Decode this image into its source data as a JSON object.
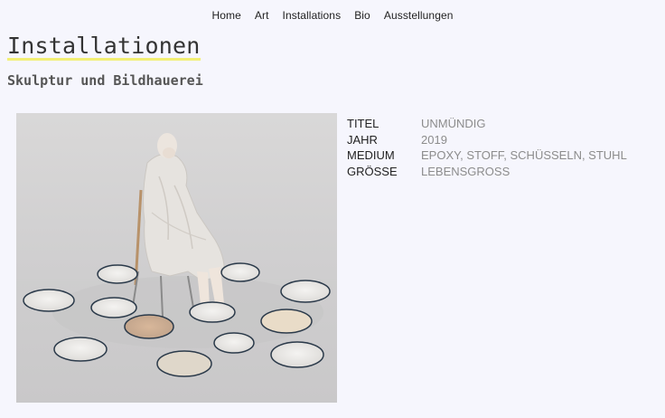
{
  "nav": {
    "items": [
      "Home",
      "Art",
      "Installations",
      "Bio",
      "Ausstellungen"
    ]
  },
  "page": {
    "title": "Installationen",
    "subtitle": "Skulptur und Bildhauerei"
  },
  "details": [
    {
      "key": "TITEL",
      "value": "UNMÜNDIG"
    },
    {
      "key": "JAHR",
      "value": "2019"
    },
    {
      "key": "MEDIUM",
      "value": "EPOXY, STOFF, SCHÜSSELN, STUHL"
    },
    {
      "key": "GRÖSSE",
      "value": "LEBENSGROSS"
    }
  ],
  "colors": {
    "background": "#f6f6fd",
    "title_underline": "#f2ef74",
    "value_text": "#8c8c8c"
  }
}
